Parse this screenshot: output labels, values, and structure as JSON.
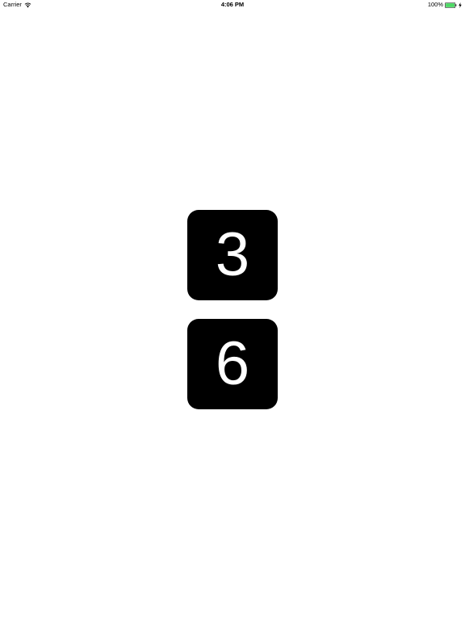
{
  "status_bar": {
    "carrier": "Carrier",
    "time": "4:06 PM",
    "battery_percent": "100%",
    "wifi_icon": "wifi-icon",
    "battery_icon": "battery-icon",
    "charging_icon": "charging-bolt-icon",
    "battery_level": 1.0,
    "battery_color": "#4cd964"
  },
  "tiles": [
    {
      "value": "3"
    },
    {
      "value": "6"
    }
  ],
  "colors": {
    "background": "#ffffff",
    "tile_background": "#000000",
    "tile_text": "#ffffff"
  }
}
